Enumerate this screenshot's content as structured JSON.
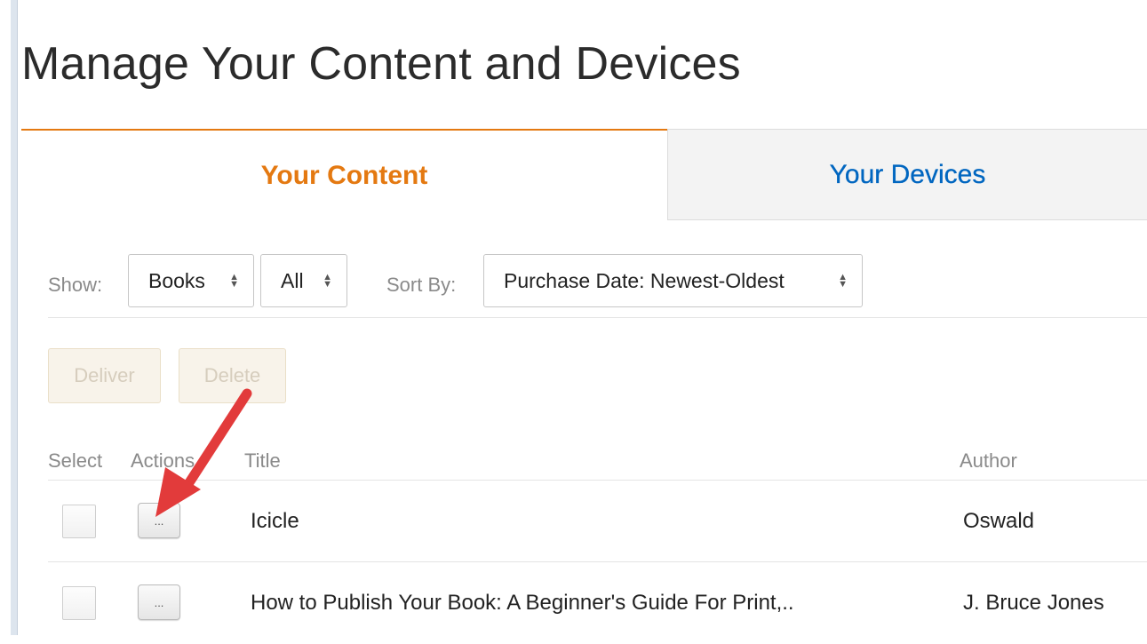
{
  "page": {
    "title": "Manage Your Content and Devices"
  },
  "tabs": [
    {
      "label": "Your Content",
      "active": true
    },
    {
      "label": "Your Devices",
      "active": false
    }
  ],
  "filters": {
    "show_label": "Show:",
    "type_value": "Books",
    "status_value": "All",
    "sort_label": "Sort By:",
    "sort_value": "Purchase Date: Newest-Oldest"
  },
  "bulk_actions": {
    "deliver_label": "Deliver",
    "delete_label": "Delete"
  },
  "table": {
    "headers": {
      "select": "Select",
      "actions": "Actions",
      "title": "Title",
      "author": "Author"
    },
    "rows": [
      {
        "action_label": "...",
        "title": "Icicle",
        "author": "Oswald"
      },
      {
        "action_label": "...",
        "title": "How to Publish Your Book: A Beginner's Guide For Print,..",
        "author": "J. Bruce Jones"
      }
    ]
  },
  "annotation": {
    "icon": "red-arrow",
    "color": "#e23b3b"
  },
  "colors": {
    "active_tab": "#e47911",
    "inactive_tab_text": "#0066c0"
  }
}
